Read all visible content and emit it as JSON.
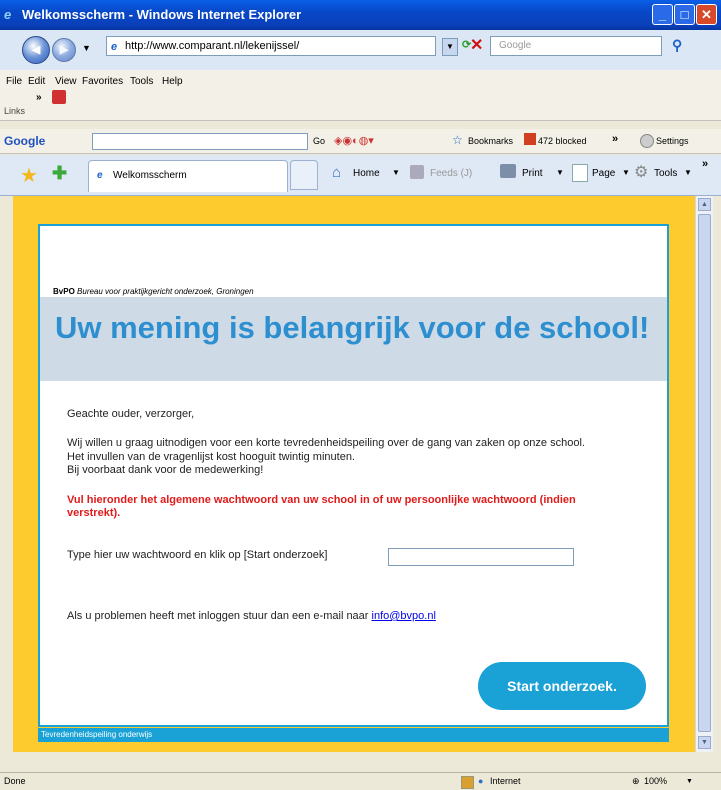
{
  "window": {
    "title": "Welkomsscherm - Windows Internet Explorer"
  },
  "address": {
    "url": "http://www.comparant.nl/lekenijssel/",
    "search_placeholder": "Google"
  },
  "menu": {
    "items": [
      "File",
      "Edit",
      "View",
      "Favorites",
      "Tools",
      "Help"
    ],
    "links_label": "Links"
  },
  "google_toolbar": {
    "logo": "Google",
    "go_label": "Go",
    "bookmarks": "Bookmarks",
    "blocked": "472 blocked",
    "settings": "Settings"
  },
  "tab": {
    "title": "Welkomsscherm"
  },
  "commandbar": {
    "home": "Home",
    "feeds": "Feeds (J)",
    "print": "Print",
    "page": "Page",
    "tools": "Tools"
  },
  "page": {
    "institute_abbr": "BvPO",
    "institute_full": "Bureau voor praktijkgericht onderzoek, Groningen",
    "headline": "Uw mening is belangrijk voor de school!",
    "greeting": "Geachte ouder, verzorger,",
    "intro_lines": [
      "Wij willen u graag uitnodigen voor een korte tevredenheidspeiling over de gang van zaken op onze school.",
      "Het invullen van de vragenlijst kost hooguit twintig minuten.",
      "Bij voorbaat dank voor de medewerking!"
    ],
    "red_notice": "Vul hieronder het algemene wachtwoord van uw school in of uw persoonlijke wachtwoord (indien verstrekt).",
    "password_label": "Type hier uw wachtwoord en klik op [Start onderzoek]",
    "password_value": "",
    "help_text": "Als u problemen heeft met inloggen stuur dan een e-mail naar",
    "help_email": "info@bvpo.nl",
    "start_button": "Start onderzoek.",
    "footer": "Tevredenheidspeiling onderwijs"
  },
  "status": {
    "left": "Done",
    "zone": "Internet",
    "zoom": "100%"
  },
  "colors": {
    "page_border": "#fecb2f",
    "accent": "#1aa1d6",
    "headline": "#2e8fd0",
    "banner": "#cedbe7",
    "notice": "#e01b1b"
  }
}
